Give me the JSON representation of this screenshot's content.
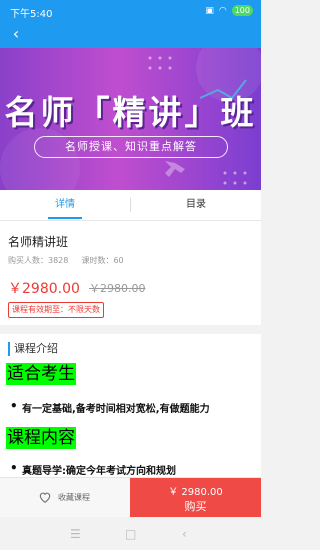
{
  "status_bar": {
    "time": "下午5:40",
    "battery": "100"
  },
  "banner": {
    "title": "名师「精讲」班",
    "subtitle": "名师授课、知识重点解答"
  },
  "tabs": [
    {
      "label": "详情"
    },
    {
      "label": "目录"
    }
  ],
  "course": {
    "title": "名师精讲班",
    "buyers_label": "购买人数：3828",
    "hours_label": "课时数：60",
    "price": "￥2980.00",
    "original_price": "￥2980.00",
    "validity": "课程有效期至：不限天数"
  },
  "intro": {
    "heading": "课程介绍",
    "section1_title": "适合考生",
    "section1_item": "有一定基础,备考时间相对宽松,有做题能力",
    "section2_title": "课程内容",
    "section2_item": "真题导学:确定今年考试方向和规划"
  },
  "bottom_bar": {
    "favorite_label": "收藏课程",
    "buy_price": "￥ 2980.00",
    "buy_label": "购买"
  },
  "colors": {
    "primary": "#1e9bf0",
    "price": "#ee3a35",
    "buy": "#f04a47",
    "highlight": "#00ff00"
  }
}
